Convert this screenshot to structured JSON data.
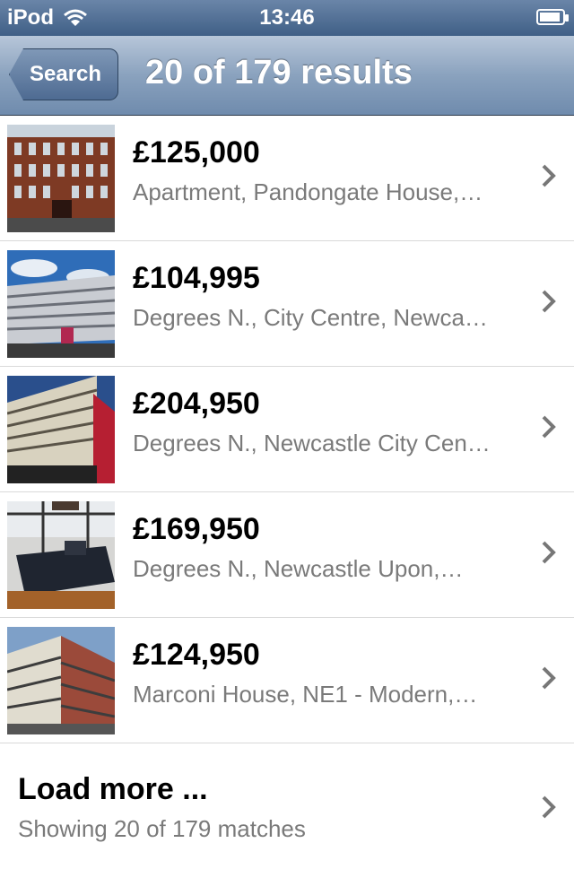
{
  "status_bar": {
    "carrier": "iPod",
    "time": "13:46"
  },
  "nav": {
    "back_label": "Search",
    "title": "20 of 179 results"
  },
  "listings": [
    {
      "price": "£125,000",
      "description": "Apartment, Pandongate House,…"
    },
    {
      "price": "£104,995",
      "description": "Degrees N., City Centre, Newca…"
    },
    {
      "price": "£204,950",
      "description": "Degrees N., Newcastle City Cen…"
    },
    {
      "price": "£169,950",
      "description": "Degrees N., Newcastle Upon,…"
    },
    {
      "price": "£124,950",
      "description": "Marconi House, NE1 - Modern,…"
    }
  ],
  "load_more": {
    "title": "Load more ...",
    "subtitle": "Showing 20 of 179 matches"
  }
}
